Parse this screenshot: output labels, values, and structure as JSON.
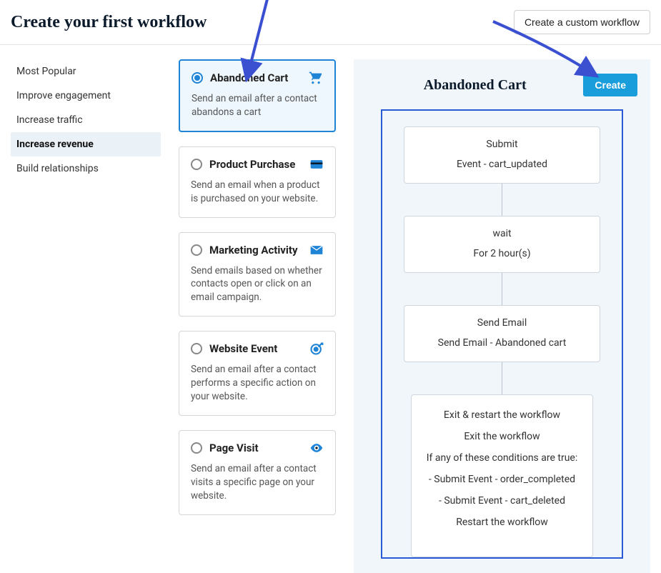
{
  "header": {
    "title": "Create your first workflow",
    "custom_button": "Create a custom workflow"
  },
  "sidebar": {
    "items": [
      {
        "label": "Most Popular",
        "active": false
      },
      {
        "label": "Improve engagement",
        "active": false
      },
      {
        "label": "Increase traffic",
        "active": false
      },
      {
        "label": "Increase revenue",
        "active": true
      },
      {
        "label": "Build relationships",
        "active": false
      }
    ]
  },
  "templates": [
    {
      "title": "Abandoned Cart",
      "desc": "Send an email after a contact abandons a cart",
      "icon": "cart-icon",
      "selected": true
    },
    {
      "title": "Product Purchase",
      "desc": "Send an email when a product is purchased on your website.",
      "icon": "credit-card-icon",
      "selected": false
    },
    {
      "title": "Marketing Activity",
      "desc": "Send emails based on whether contacts open or click on an email campaign.",
      "icon": "envelope-icon",
      "selected": false
    },
    {
      "title": "Website Event",
      "desc": "Send an email after a contact performs a specific action on your website.",
      "icon": "target-icon",
      "selected": false
    },
    {
      "title": "Page Visit",
      "desc": "Send an email after a contact visits a specific page on your website.",
      "icon": "eye-icon",
      "selected": false
    }
  ],
  "preview": {
    "title": "Abandoned Cart",
    "create_button": "Create",
    "nodes": [
      {
        "top": "Submit",
        "sub": "Event - cart_updated"
      },
      {
        "top": "wait",
        "sub": "For 2 hour(s)"
      },
      {
        "top": "Send Email",
        "sub": "Send Email - Abandoned cart"
      }
    ],
    "exit": {
      "heading": "Exit & restart the workflow",
      "exit_label": "Exit the workflow",
      "condition_intro": "If any of these conditions are true:",
      "conditions": [
        "- Submit Event - order_completed",
        "- Submit Event - cart_deleted"
      ],
      "restart_label": "Restart the workflow"
    }
  }
}
